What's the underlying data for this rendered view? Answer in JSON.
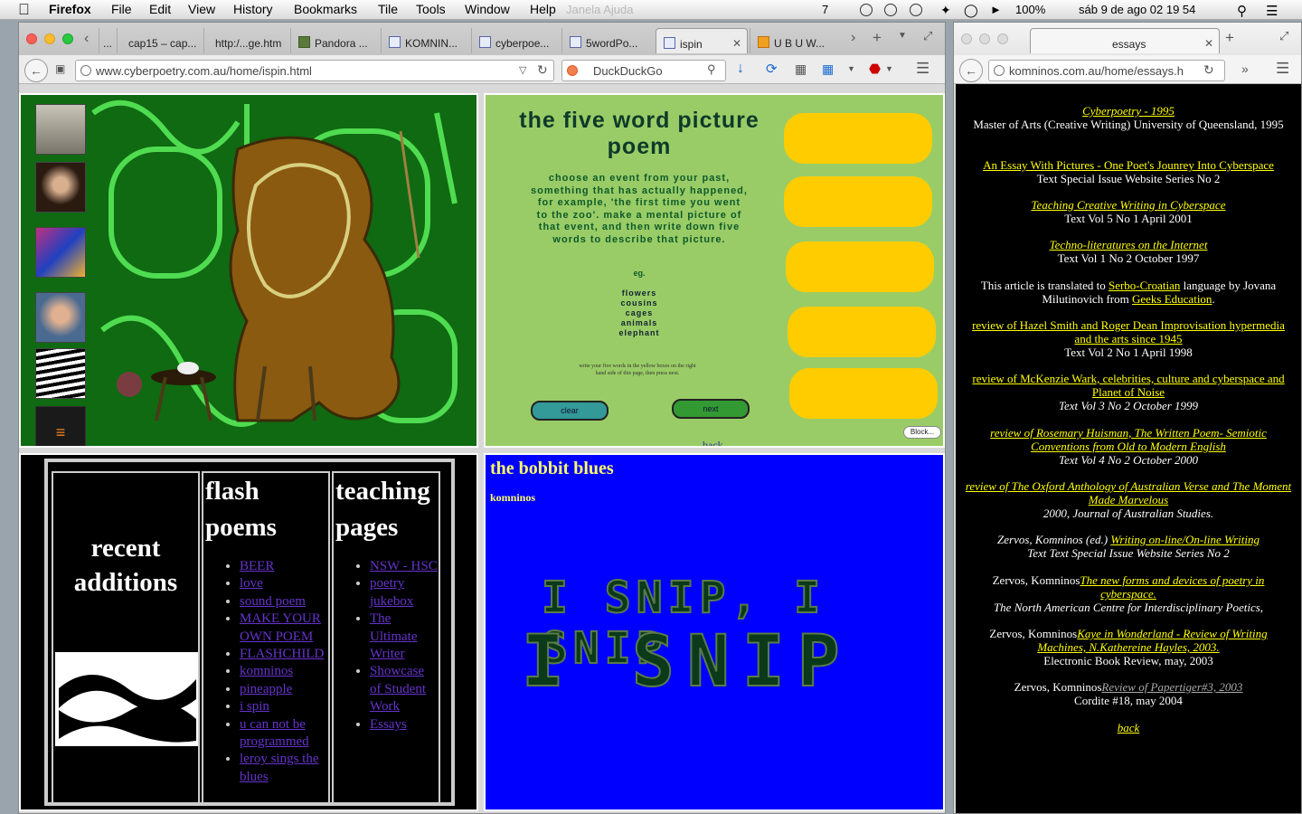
{
  "menubar": {
    "app": "Firefox",
    "items": [
      "File",
      "Edit",
      "View",
      "History",
      "Bookmarks",
      "Tile",
      "Tools",
      "Window",
      "Help"
    ],
    "ghost_text": "Janela   Ajuda",
    "status": {
      "notif_count": "7",
      "battery": "100%",
      "datetime": "sáb 9 de ago  02 19 54"
    }
  },
  "main_window": {
    "tabs": [
      {
        "label": "..."
      },
      {
        "label": "cap15 – cap..."
      },
      {
        "label": "http:/...ge.htm"
      },
      {
        "label": "Pandora ..."
      },
      {
        "label": "KOMNIN..."
      },
      {
        "label": "cyberpoe..."
      },
      {
        "label": "5wordPo..."
      },
      {
        "label": "ispin"
      },
      {
        "label": "U B U W..."
      }
    ],
    "url": "www.cyberpoetry.com.au/home/ispin.html",
    "search_placeholder": "DuckDuckGo"
  },
  "frame_poem": {
    "title": "the five word picture poem",
    "instructions": "choose an event from your past, something that has actually happened, for example, 'the first time you went to the zoo'. make a mental picture of that event, and then write down five words to describe that picture.",
    "eg": "eg.",
    "words": [
      "flowers",
      "cousins",
      "cages",
      "animals",
      "elephant"
    ],
    "small_note": "write your five words in the yellow boxes on the right hand side of this page, then press next.",
    "clear_label": "clear",
    "next_label": "next",
    "back_label": "back",
    "block_label": "Block..."
  },
  "frame_nav": {
    "recent_title": "recent additions",
    "flash_title": "flash poems",
    "flash_items": [
      "BEER",
      "love",
      "sound poem",
      "MAKE YOUR OWN POEM",
      "FLASHCHILD",
      "komninos",
      "pineapple",
      "i spin",
      "u can not be programmed",
      "leroy sings the blues"
    ],
    "teaching_title": "teaching pages",
    "teaching_items": [
      "NSW - HSC",
      "poetry jukebox",
      "The Ultimate Writer",
      "Showcase of Student Work",
      "Essays"
    ]
  },
  "frame_blues": {
    "title": "the bobbit blues",
    "author": "komninos",
    "snip_line1": "I SNIP, I SNIP",
    "snip_line2": "I SNIP"
  },
  "essays_window": {
    "tab_label": "essays",
    "url": "komninos.com.au/home/essays.h",
    "entries": [
      {
        "link": "Cyberpoetry - 1995",
        "text": "Master of Arts (Creative Writing) University of Queensland, 1995"
      },
      {
        "link": "An Essay With Pictures - One Poet's Jounrey Into Cyberspace",
        "text": "Text Special Issue Website Series No 2"
      },
      {
        "link": "Teaching Creative Writing in Cyberspace",
        "text": "Text Vol 5 No 1 April 2001"
      },
      {
        "link": "Techno-literatures on the Internet",
        "text": "Text Vol 1 No 2 October 1997"
      },
      {
        "pre": "This article is translated to ",
        "link": "Serbo-Croatian",
        "mid": " language by Jovana Milutinovich from ",
        "link2": "Geeks Education",
        "post": "."
      },
      {
        "link": "review of Hazel Smith and Roger Dean Improvisation hypermedia and the arts since 1945",
        "text": "Text Vol 2 No 1 April 1998"
      },
      {
        "link": "review of McKenzie Wark, celebrities, culture and cyberspace and Planet of Noise",
        "text": "Text Vol 3 No 2 October 1999"
      },
      {
        "link": "review of Rosemary Huisman, The Written Poem- Semiotic Conventions from Old to Modern English",
        "text": "Text Vol 4 No 2 October 2000"
      },
      {
        "link": "review of The Oxford Anthology of Australian Verse and The Moment Made Marvelous",
        "text": "2000, Journal of Australian Studies."
      },
      {
        "pre": "Zervos, Komninos (ed.) ",
        "link": "Writing on-line/On-line Writing",
        "text": "Text Text Special Issue Website Series No 2"
      },
      {
        "pre": "Zervos, Komninos",
        "link": "The new forms and devices of poetry in cyberspace.",
        "text": "The North American Centre for Interdisciplinary Poetics,"
      },
      {
        "pre": "Zervos, Komninos",
        "link": "Kaye in Wonderland - Review of Writing Machines, N.Kathereine Hayles, 2003.",
        "text": "Electronic Book Review, may, 2003"
      },
      {
        "pre": "Zervos, Komninos",
        "link": "Review of Papertiger#3, 2003",
        "text": "Cordite #18, may 2004"
      }
    ],
    "back_label": "back"
  }
}
